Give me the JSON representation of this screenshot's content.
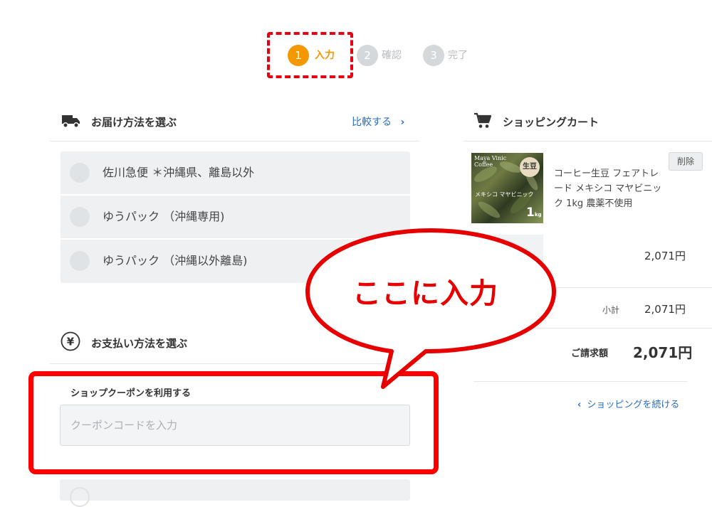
{
  "steps": [
    {
      "num": "1",
      "label": "入力",
      "active": true
    },
    {
      "num": "2",
      "label": "確認",
      "active": false
    },
    {
      "num": "3",
      "label": "完了",
      "active": false
    }
  ],
  "delivery": {
    "title": "お届け方法を選ぶ",
    "compare_label": "比較する",
    "options": [
      "佐川急便 ＊沖縄県、離島以外",
      "ゆうパック （沖縄専用)",
      "ゆうパック （沖縄以外離島)"
    ]
  },
  "payment": {
    "title": "お支払い方法を選ぶ",
    "coupon_label": "ショップクーポンを利用する",
    "coupon_placeholder": "クーポンコードを入力"
  },
  "callout": {
    "text": "ここに入力"
  },
  "cart": {
    "title": "ショッピングカート",
    "delete_label": "削除",
    "product": {
      "name": "コーヒー生豆 フェアトレード メキシコ マヤビニック 1kg 農薬不使用",
      "image_text_top": "Maya Vinic Coffee",
      "image_badge": "生豆",
      "image_caption": "メキシコ マヤビニック",
      "image_weight": "1",
      "image_weight_unit": "kg",
      "price": "2,071円"
    },
    "subtotal_label": "小計",
    "subtotal_value": "2,071円",
    "total_label": "ご請求額",
    "total_value": "2,071円",
    "continue_label": "ショッピングを続ける"
  },
  "colors": {
    "accent": "#f39800",
    "link": "#2a6ebb",
    "highlight": "#ff0000"
  }
}
